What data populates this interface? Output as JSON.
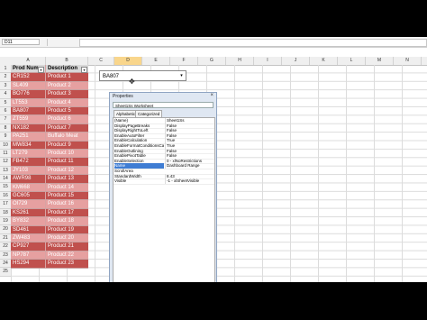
{
  "formula_bar": {
    "name_box": "D11"
  },
  "columns": [
    "A",
    "B",
    "C",
    "D",
    "E",
    "F",
    "G",
    "H",
    "I",
    "J",
    "K",
    "L",
    "M",
    "N"
  ],
  "active_column": "D",
  "row_numbers": [
    "1",
    "2",
    "3",
    "4",
    "5",
    "6",
    "7",
    "8",
    "9",
    "10",
    "11",
    "12",
    "13",
    "14",
    "15",
    "16",
    "17",
    "18",
    "19",
    "20",
    "21",
    "22",
    "23",
    "24",
    "25"
  ],
  "table": {
    "headers": [
      "Prod Num",
      "Description"
    ],
    "rows": [
      [
        "CR152",
        "Product 1"
      ],
      [
        "SL409",
        "Product 2"
      ],
      [
        "BO776",
        "Product 3"
      ],
      [
        "LT553",
        "Product 4"
      ],
      [
        "BA807",
        "Product 5"
      ],
      [
        "ZT559",
        "Product 6"
      ],
      [
        "NX182",
        "Product 7"
      ],
      [
        "PA251",
        "Buffalo Meat"
      ],
      [
        "MW834",
        "Product 9"
      ],
      [
        "LT279",
        "Product 10"
      ],
      [
        "FB472",
        "Product 11"
      ],
      [
        "JY103",
        "Product 12"
      ],
      [
        "AWR98",
        "Product 13"
      ],
      [
        "KM668",
        "Product 14"
      ],
      [
        "GC605",
        "Product 15"
      ],
      [
        "OI729",
        "Product 16"
      ],
      [
        "KS261",
        "Product 17"
      ],
      [
        "BY832",
        "Product 18"
      ],
      [
        "SD461",
        "Product 19"
      ],
      [
        "ZW483",
        "Product 20"
      ],
      [
        "CP927",
        "Product 21"
      ],
      [
        "NP787",
        "Product 22"
      ],
      [
        "HS294",
        "Product 23"
      ]
    ]
  },
  "row_colors": [
    "#c0504d",
    "#e6a0a0",
    "#c0504d",
    "#e6a0a0",
    "#c0504d",
    "#e6a0a0",
    "#c0504d",
    "#e6a0a0",
    "#c0504d",
    "#e6a0a0",
    "#c0504d",
    "#e6a0a0",
    "#c0504d",
    "#e6a0a0",
    "#c0504d",
    "#e6a0a0",
    "#c0504d",
    "#e6a0a0",
    "#c0504d",
    "#e6a0a0",
    "#c0504d",
    "#e6a0a0",
    "#c0504d"
  ],
  "dropdown": {
    "value": "BA807"
  },
  "properties": {
    "title": "Properties",
    "object": "Sheet1Ss Worksheet",
    "tabs": [
      "Alphabetic",
      "Categorized"
    ],
    "rows": [
      [
        "(Name)",
        "Sheet1Ss"
      ],
      [
        "DisplayPageBreaks",
        "False"
      ],
      [
        "DisplayRightToLeft",
        "False"
      ],
      [
        "EnableAutoFilter",
        "False"
      ],
      [
        "EnableCalculation",
        "True"
      ],
      [
        "EnableFormatConditionsCalcul",
        "True"
      ],
      [
        "EnableOutlining",
        "False"
      ],
      [
        "EnablePivotTable",
        "False"
      ],
      [
        "EnableSelection",
        "0 - xlNoRestrictions"
      ],
      [
        "Name",
        "Dashboard Range"
      ],
      [
        "ScrollArea",
        ""
      ],
      [
        "StandardWidth",
        "8.43"
      ],
      [
        "Visible",
        "-1 - xlSheetVisible"
      ]
    ]
  }
}
